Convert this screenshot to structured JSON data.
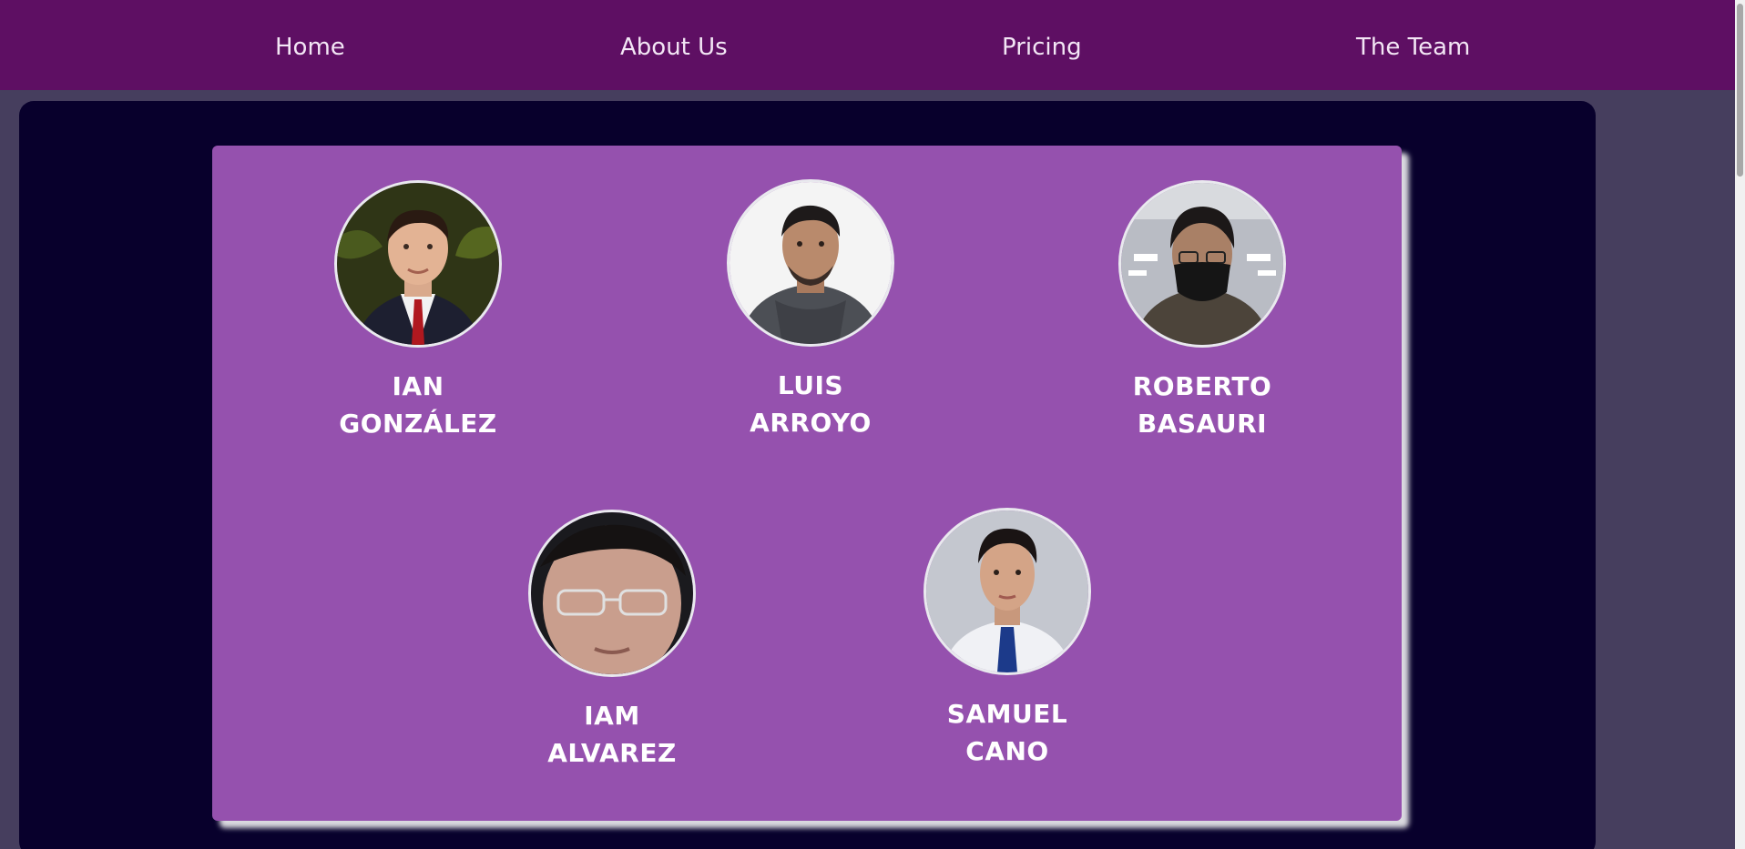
{
  "nav": {
    "items": [
      {
        "label": "Home"
      },
      {
        "label": "About Us"
      },
      {
        "label": "Pricing"
      },
      {
        "label": "The Team"
      }
    ]
  },
  "team": {
    "members": [
      {
        "first": "IAN",
        "last": "GONZÁLEZ"
      },
      {
        "first": "LUIS",
        "last": "ARROYO"
      },
      {
        "first": "ROBERTO",
        "last": "BASAURI"
      },
      {
        "first": "IAM",
        "last": "ALVAREZ"
      },
      {
        "first": "SAMUEL",
        "last": "CANO"
      }
    ]
  },
  "colors": {
    "nav_bg": "#5e0f63",
    "page_bg": "#463e5e",
    "panel_bg": "#08002c",
    "card_bg": "#9551ae",
    "text": "#ffffff"
  }
}
